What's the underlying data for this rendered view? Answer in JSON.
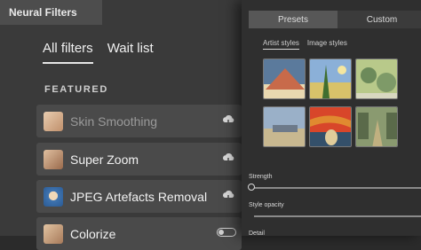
{
  "app_panel": {
    "title": "Neural Filters"
  },
  "filter_tabs": [
    {
      "label": "All filters",
      "active": true
    },
    {
      "label": "Wait list",
      "active": false
    }
  ],
  "section_heading": "FEATURED",
  "filters": [
    {
      "label": "Skin Smoothing",
      "enabled": false,
      "action_icon": "cloud-download-icon",
      "thumb_color": "#d9b190"
    },
    {
      "label": "Super Zoom",
      "enabled": true,
      "action_icon": "cloud-download-icon",
      "thumb_color": "#b98c6e"
    },
    {
      "label": "JPEG Artefacts Removal",
      "enabled": true,
      "action_icon": "cloud-download-icon",
      "thumb_color": "#4a7fb8"
    },
    {
      "label": "Colorize",
      "enabled": true,
      "action_icon": "toggle-icon",
      "thumb_color": "#c79a72"
    }
  ],
  "style_panel": {
    "segment_tabs": [
      {
        "label": "Presets",
        "active": true
      },
      {
        "label": "Custom",
        "active": false
      }
    ],
    "sub_tabs": [
      {
        "label": "Artist styles",
        "active": true
      },
      {
        "label": "Image styles",
        "active": false
      }
    ],
    "presets": [
      {
        "name": "mountain-style",
        "colors": [
          "#c86a4a",
          "#e8d8b0",
          "#5b7a9c"
        ]
      },
      {
        "name": "cypress-field-style",
        "colors": [
          "#8bb0d8",
          "#3f6e2f",
          "#d8c26a"
        ]
      },
      {
        "name": "garden-style",
        "colors": [
          "#b8c98a",
          "#6c8a5a",
          "#d8d8c0"
        ]
      },
      {
        "name": "pastoral-style",
        "colors": [
          "#9ab0c8",
          "#c8b890",
          "#6d7a8a"
        ]
      },
      {
        "name": "scream-style",
        "colors": [
          "#d8462a",
          "#e08a30",
          "#34506a"
        ]
      },
      {
        "name": "street-style",
        "colors": [
          "#8a9a70",
          "#c0b080",
          "#5a6a4a"
        ]
      }
    ],
    "controls": [
      {
        "label": "Strength",
        "value": 0
      },
      {
        "label": "Style opacity"
      },
      {
        "label": "Detail"
      }
    ]
  }
}
